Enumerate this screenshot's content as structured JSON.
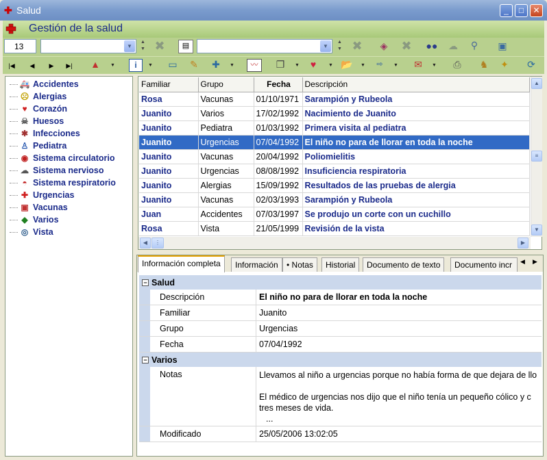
{
  "window": {
    "title": "Salud"
  },
  "header": {
    "title": "Gestión de la salud"
  },
  "toolbar": {
    "record_number": "13"
  },
  "sidebar": {
    "items": [
      {
        "label": "Accidentes",
        "icon": "ambulance-icon",
        "glyph": "🚑"
      },
      {
        "label": "Alergias",
        "icon": "allergy-face-icon",
        "glyph": "☹"
      },
      {
        "label": "Corazón",
        "icon": "heart-icon",
        "glyph": "♥"
      },
      {
        "label": "Huesos",
        "icon": "skull-icon",
        "glyph": "☠"
      },
      {
        "label": "Infecciones",
        "icon": "germ-icon",
        "glyph": "✱"
      },
      {
        "label": "Pediatra",
        "icon": "baby-icon",
        "glyph": "♙"
      },
      {
        "label": "Sistema circulatorio",
        "icon": "circulatory-icon",
        "glyph": "◉"
      },
      {
        "label": "Sistema nervioso",
        "icon": "brain-icon",
        "glyph": "☁"
      },
      {
        "label": "Sistema respiratorio",
        "icon": "lips-icon",
        "glyph": "◓"
      },
      {
        "label": "Urgencias",
        "icon": "red-cross-icon",
        "glyph": "✚"
      },
      {
        "label": "Vacunas",
        "icon": "vaccine-icon",
        "glyph": "▣"
      },
      {
        "label": "Varios",
        "icon": "shapes-icon",
        "glyph": "◆"
      },
      {
        "label": "Vista",
        "icon": "eye-icon",
        "glyph": "◎"
      }
    ]
  },
  "grid": {
    "columns": [
      "Familiar",
      "Grupo",
      "Fecha",
      "Descripción"
    ],
    "rows": [
      {
        "familiar": "Rosa",
        "grupo": "Vacunas",
        "fecha": "01/10/1971",
        "descripcion": "Sarampión y Rubeola"
      },
      {
        "familiar": "Juanito",
        "grupo": "Varios",
        "fecha": "17/02/1992",
        "descripcion": "Nacimiento de Juanito"
      },
      {
        "familiar": "Juanito",
        "grupo": "Pediatra",
        "fecha": "01/03/1992",
        "descripcion": "Primera visita al pediatra"
      },
      {
        "familiar": "Juanito",
        "grupo": "Urgencias",
        "fecha": "07/04/1992",
        "descripcion": "El niño no para de llorar en toda la noche",
        "selected": true
      },
      {
        "familiar": "Juanito",
        "grupo": "Vacunas",
        "fecha": "20/04/1992",
        "descripcion": "Poliomielitis"
      },
      {
        "familiar": "Juanito",
        "grupo": "Urgencias",
        "fecha": "08/08/1992",
        "descripcion": "Insuficiencia respiratoria"
      },
      {
        "familiar": "Juanito",
        "grupo": "Alergias",
        "fecha": "15/09/1992",
        "descripcion": "Resultados de las pruebas de alergia"
      },
      {
        "familiar": "Juanito",
        "grupo": "Vacunas",
        "fecha": "02/03/1993",
        "descripcion": "Sarampión y Rubeola"
      },
      {
        "familiar": "Juan",
        "grupo": "Accidentes",
        "fecha": "07/03/1997",
        "descripcion": "Se produjo un corte con un cuchillo"
      },
      {
        "familiar": "Rosa",
        "grupo": "Vista",
        "fecha": "21/05/1999",
        "descripcion": "Revisión de la vista"
      }
    ]
  },
  "tabs": [
    {
      "label": "Información completa",
      "active": true
    },
    {
      "label": "Información"
    },
    {
      "label": "• Notas"
    },
    {
      "label": "Historial"
    },
    {
      "label": "Documento de texto"
    },
    {
      "label": "Documento incr"
    }
  ],
  "details": {
    "salud": {
      "category": "Salud",
      "descripcion_label": "Descripción",
      "descripcion": "El niño no para de llorar en toda la noche",
      "familiar_label": "Familiar",
      "familiar": "Juanito",
      "grupo_label": "Grupo",
      "grupo": "Urgencias",
      "fecha_label": "Fecha",
      "fecha": "07/04/1992"
    },
    "varios": {
      "category": "Varios",
      "notas_label": "Notas",
      "notas_line1": "Llevamos al niño a urgencias porque no había forma de que dejara de llo",
      "notas_line2": "El médico de urgencias nos dijo que el niño tenía un pequeño cólico y c",
      "notas_line3": "tres meses de vida.",
      "notas_more": "...",
      "modificado_label": "Modificado",
      "modificado": "25/05/2006 13:02:05"
    }
  }
}
